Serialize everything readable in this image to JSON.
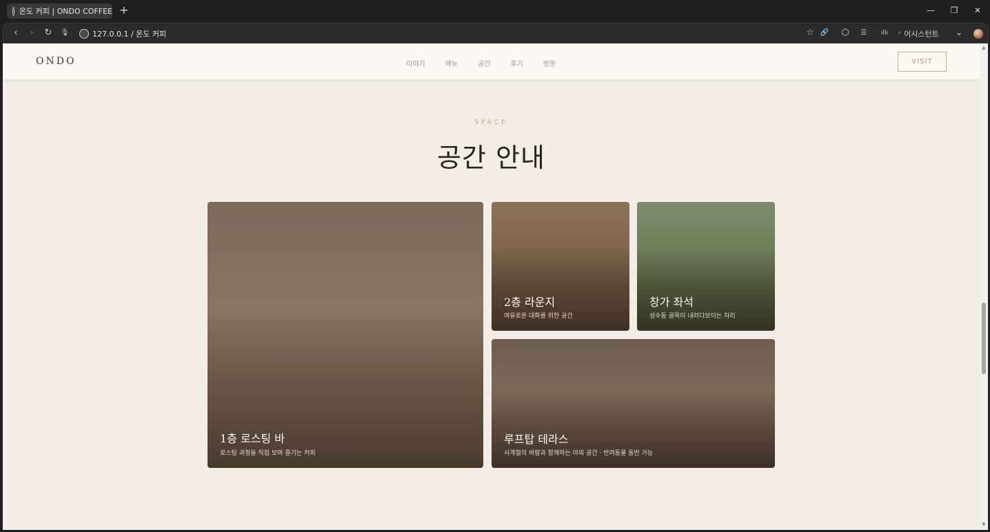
{
  "browser": {
    "tab_title": "온도 커피 | ONDO COFFEE",
    "new_tab": "+",
    "address": "127.0.0.1 / 온도 커피",
    "assistant_label": "어시스턴트",
    "window_controls": {
      "minimize": "—",
      "restore": "❐",
      "close": "✕"
    },
    "toolbar_icons": {
      "back": "‹",
      "forward": "›",
      "reload": "↻",
      "mic": "🎙",
      "star": "☆",
      "link": "🔗",
      "extensions": "⬡",
      "menu": "☰",
      "voice": "ıllı",
      "chevron": "⌄"
    }
  },
  "site": {
    "logo": "ONDO",
    "nav": [
      "이야기",
      "메뉴",
      "공간",
      "후기",
      "방문"
    ],
    "visit_label": "VISIT"
  },
  "section": {
    "eyebrow": "SPACE",
    "title": "공간 안내",
    "cards": [
      {
        "title": "1층 로스팅 바",
        "subtitle": "로스팅 과정을 직접 보며 즐기는 커피"
      },
      {
        "title": "2층 라운지",
        "subtitle": "여유로운 대화를 위한 공간"
      },
      {
        "title": "창가 좌석",
        "subtitle": "성수동 골목이 내려다보이는 자리"
      },
      {
        "title": "루프탑 테라스",
        "subtitle": "사계절의 바람과 함께하는 야외 공간 · 반려동물 동반 가능"
      }
    ]
  }
}
